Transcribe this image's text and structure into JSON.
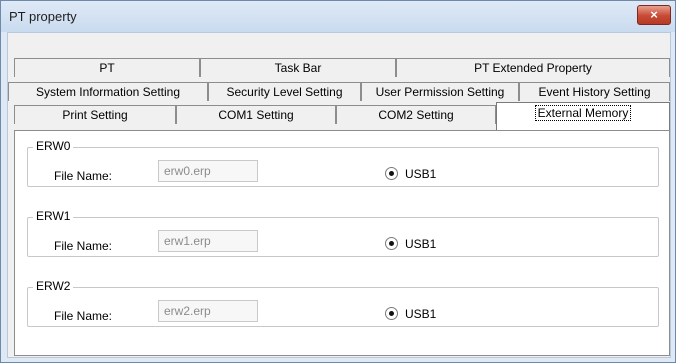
{
  "window": {
    "title": "PT property",
    "close_symbol": "×",
    "close_icon": "close-icon"
  },
  "tabs": {
    "row1": [
      "PT",
      "Task Bar",
      "PT Extended Property"
    ],
    "row2": [
      "System Information Setting",
      "Security Level Setting",
      "User Permission Setting",
      "Event History Setting"
    ],
    "row3": [
      "Print Setting",
      "COM1 Setting",
      "COM2 Setting",
      "External Memory"
    ],
    "selected": "External Memory"
  },
  "groups": [
    {
      "name": "ERW0",
      "file_label": "File Name:",
      "file_value": "erw0.erp",
      "option": "USB1",
      "selected": true
    },
    {
      "name": "ERW1",
      "file_label": "File Name:",
      "file_value": "erw1.erp",
      "option": "USB1",
      "selected": true
    },
    {
      "name": "ERW2",
      "file_label": "File Name:",
      "file_value": "erw2.erp",
      "option": "USB1",
      "selected": true
    }
  ],
  "colors": {
    "titlebar": "#dfe9f5",
    "close_button": "#c74a34",
    "panel": "#ffffff",
    "background": "#f0f0f0"
  }
}
